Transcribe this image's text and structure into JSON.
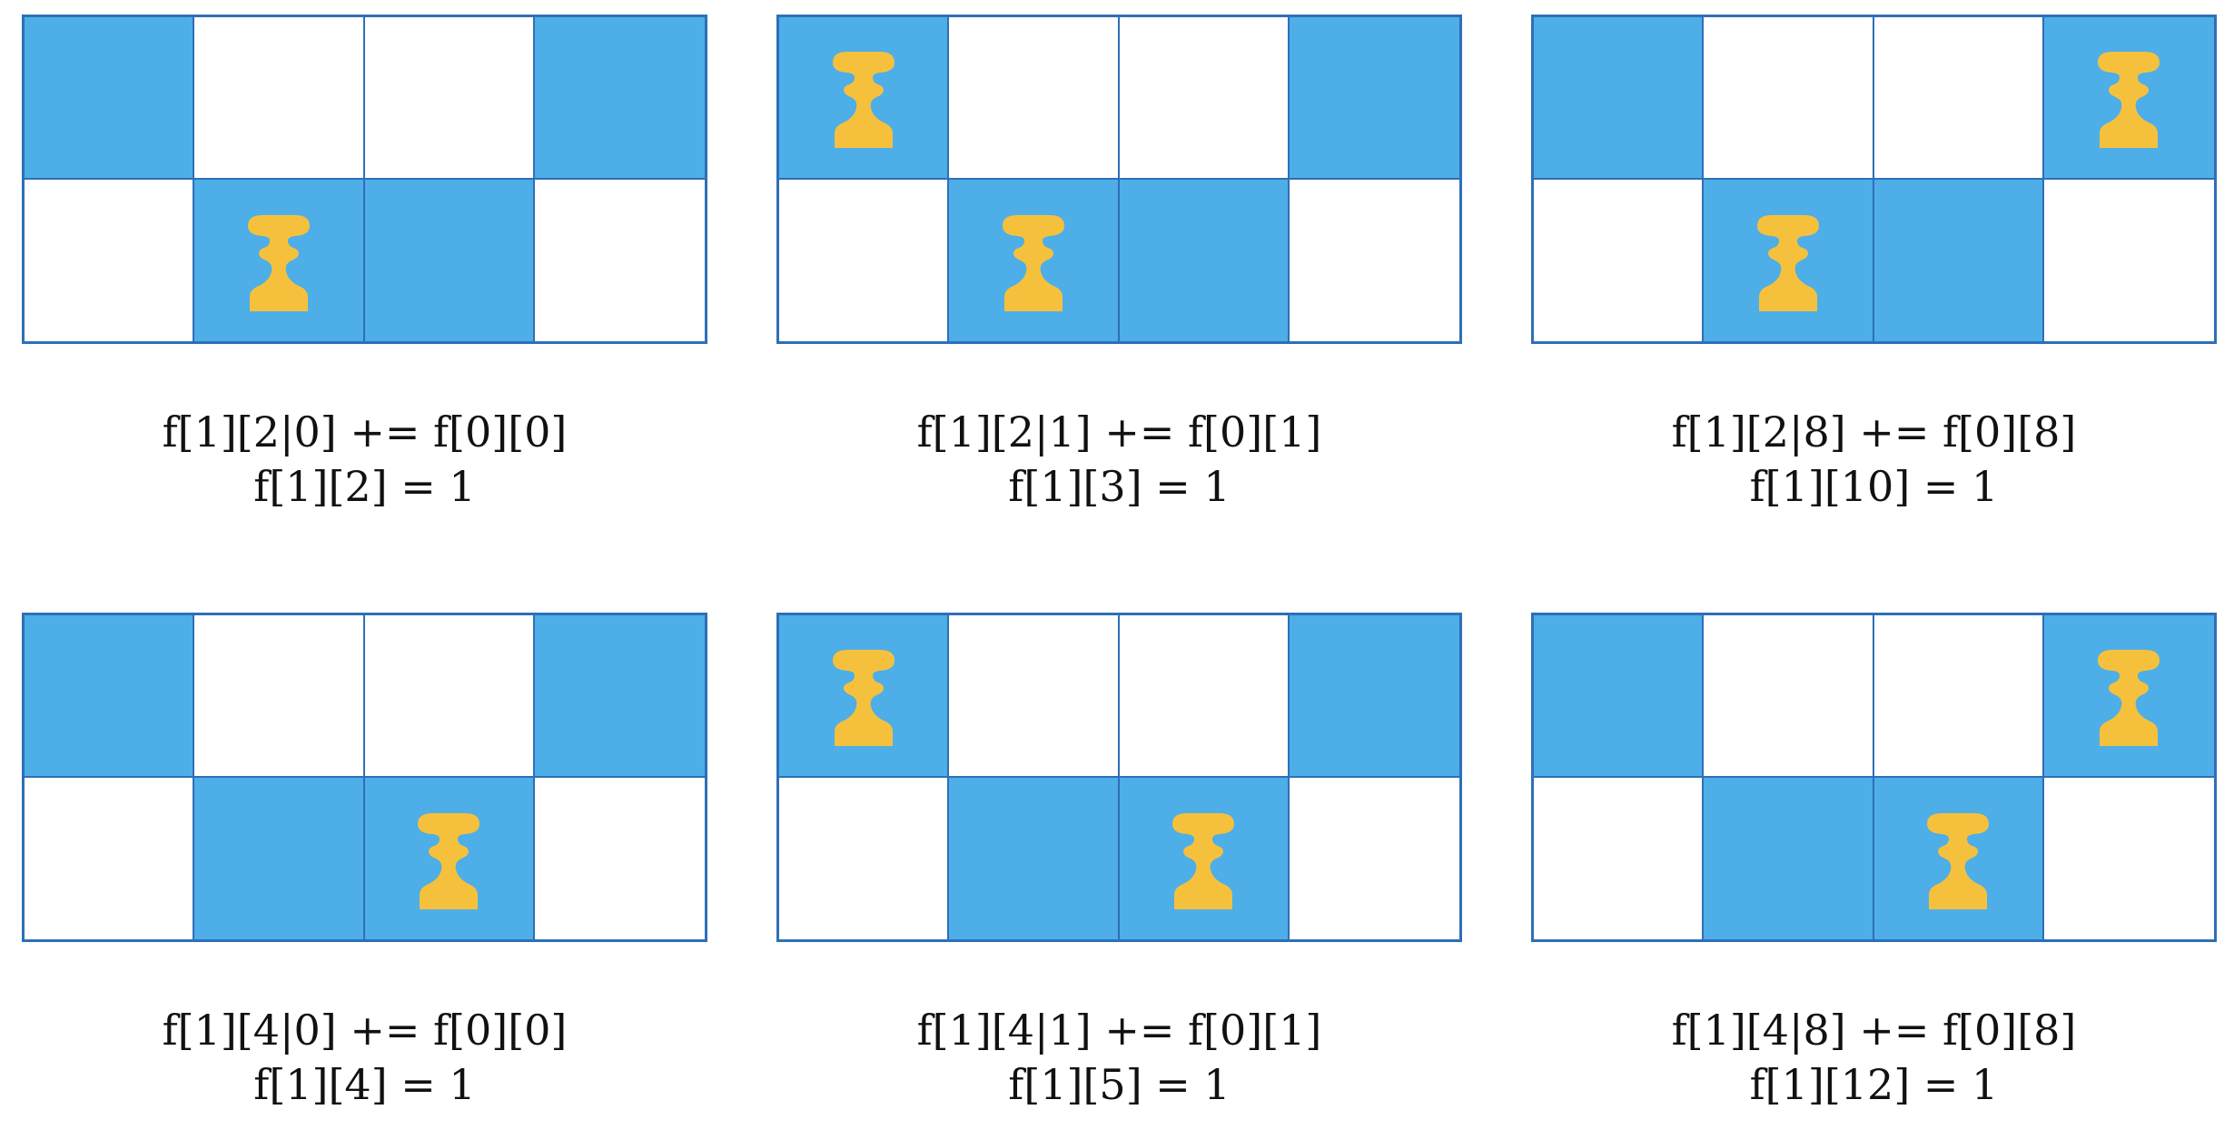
{
  "colors": {
    "filled_cell": "#4daee8",
    "empty_cell": "#ffffff",
    "grid_border": "#2e6fb8",
    "pawn": "#f5c13d"
  },
  "icons": {
    "pawn": "pawn-icon"
  },
  "panels": [
    {
      "filled": [
        [
          true,
          false,
          false,
          true
        ],
        [
          false,
          true,
          true,
          false
        ]
      ],
      "pawns": [
        [
          false,
          false,
          false,
          false
        ],
        [
          false,
          true,
          false,
          false
        ]
      ],
      "caption": {
        "line1": "f[1][2|0] += f[0][0]",
        "line2": "f[1][2] = 1"
      }
    },
    {
      "filled": [
        [
          true,
          false,
          false,
          true
        ],
        [
          false,
          true,
          true,
          false
        ]
      ],
      "pawns": [
        [
          true,
          false,
          false,
          false
        ],
        [
          false,
          true,
          false,
          false
        ]
      ],
      "caption": {
        "line1": "f[1][2|1] += f[0][1]",
        "line2": "f[1][3] = 1"
      }
    },
    {
      "filled": [
        [
          true,
          false,
          false,
          true
        ],
        [
          false,
          true,
          true,
          false
        ]
      ],
      "pawns": [
        [
          false,
          false,
          false,
          true
        ],
        [
          false,
          true,
          false,
          false
        ]
      ],
      "caption": {
        "line1": "f[1][2|8] += f[0][8]",
        "line2": "f[1][10] = 1"
      }
    },
    {
      "filled": [
        [
          true,
          false,
          false,
          true
        ],
        [
          false,
          true,
          true,
          false
        ]
      ],
      "pawns": [
        [
          false,
          false,
          false,
          false
        ],
        [
          false,
          false,
          true,
          false
        ]
      ],
      "caption": {
        "line1": "f[1][4|0] += f[0][0]",
        "line2": "f[1][4] = 1"
      }
    },
    {
      "filled": [
        [
          true,
          false,
          false,
          true
        ],
        [
          false,
          true,
          true,
          false
        ]
      ],
      "pawns": [
        [
          true,
          false,
          false,
          false
        ],
        [
          false,
          false,
          true,
          false
        ]
      ],
      "caption": {
        "line1": "f[1][4|1] += f[0][1]",
        "line2": "f[1][5] = 1"
      }
    },
    {
      "filled": [
        [
          true,
          false,
          false,
          true
        ],
        [
          false,
          true,
          true,
          false
        ]
      ],
      "pawns": [
        [
          false,
          false,
          false,
          true
        ],
        [
          false,
          false,
          true,
          false
        ]
      ],
      "caption": {
        "line1": "f[1][4|8] += f[0][8]",
        "line2": "f[1][12] = 1"
      }
    }
  ]
}
